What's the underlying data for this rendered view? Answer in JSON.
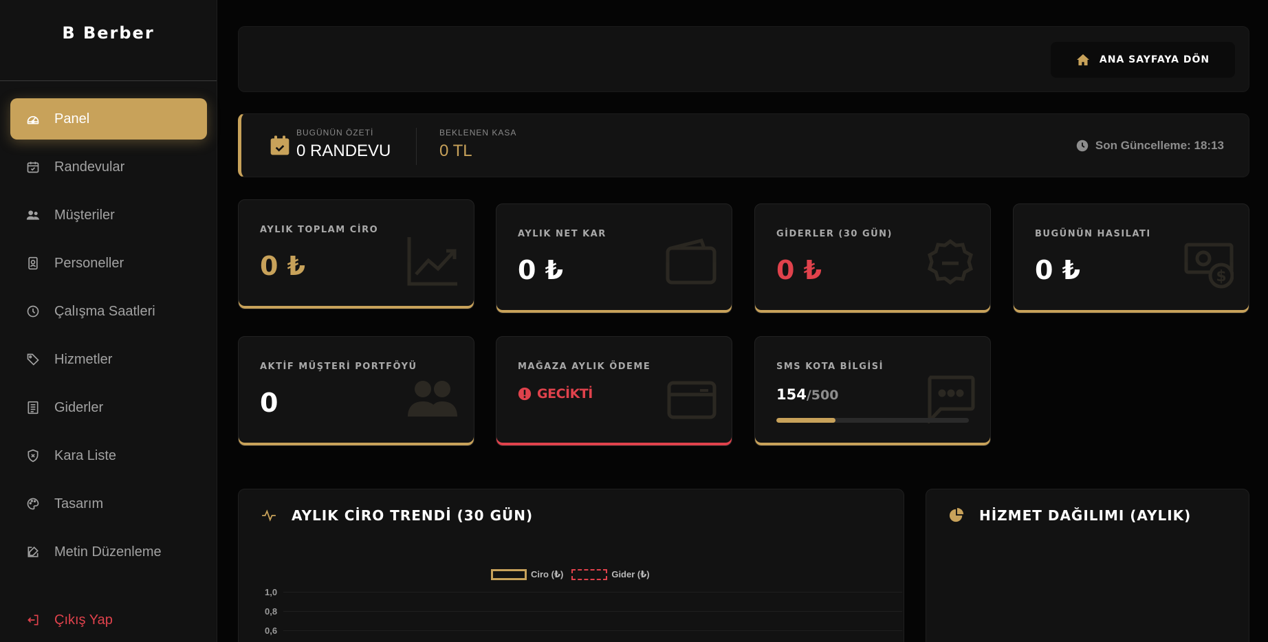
{
  "sidebar": {
    "brand": "B Berber",
    "items": [
      {
        "label": "Panel",
        "icon": "gauge-icon"
      },
      {
        "label": "Randevular",
        "icon": "calendar-check-icon"
      },
      {
        "label": "Müşteriler",
        "icon": "users-icon"
      },
      {
        "label": "Personeller",
        "icon": "id-badge-icon"
      },
      {
        "label": "Çalışma Saatleri",
        "icon": "clock-icon"
      },
      {
        "label": "Hizmetler",
        "icon": "tags-icon"
      },
      {
        "label": "Giderler",
        "icon": "receipt-icon"
      },
      {
        "label": "Kara Liste",
        "icon": "shield-icon"
      },
      {
        "label": "Tasarım",
        "icon": "palette-icon"
      },
      {
        "label": "Metin Düzenleme",
        "icon": "edit-icon"
      }
    ],
    "logout": "Çıkış Yap"
  },
  "header": {
    "home_button": "ANA SAYFAYA DÖN"
  },
  "summary": {
    "today_label": "BUGÜNÜN ÖZETİ",
    "today_value": "0 RANDEVU",
    "expected_label": "BEKLENEN KASA",
    "expected_value": "0 TL",
    "last_update": "Son Güncelleme: 18:13"
  },
  "stats": {
    "monthly_revenue": {
      "title": "AYLIK TOPLAM CİRO",
      "value": "0 ₺"
    },
    "monthly_net": {
      "title": "AYLIK NET KAR",
      "value": "0 ₺"
    },
    "expenses": {
      "title": "GİDERLER (30 GÜN)",
      "value": "0 ₺"
    },
    "today_income": {
      "title": "BUGÜNÜN HASILATI",
      "value": "0 ₺"
    },
    "customers": {
      "title": "AKTİF MÜŞTERİ PORTFÖYÜ",
      "value": "0"
    },
    "store_payment": {
      "title": "MAĞAZA AYLIK ÖDEME",
      "status": "GECİKTİ"
    },
    "sms": {
      "title": "SMS KOTA BİLGİSİ",
      "used": "154",
      "total": "/500",
      "fraction": 0.308
    }
  },
  "trend": {
    "title": "AYLIK CİRO TRENDİ (30 GÜN)",
    "legend_ciro": "Ciro (₺)",
    "legend_gider": "Gider (₺)",
    "ticks": [
      "1,0",
      "0,8",
      "0,6"
    ]
  },
  "distribution": {
    "title": "HİZMET DAĞILIMI (AYLIK)"
  },
  "colors": {
    "gold": "#c8a25a",
    "red": "#e0424c",
    "bg": "#050505",
    "card": "#131313"
  }
}
